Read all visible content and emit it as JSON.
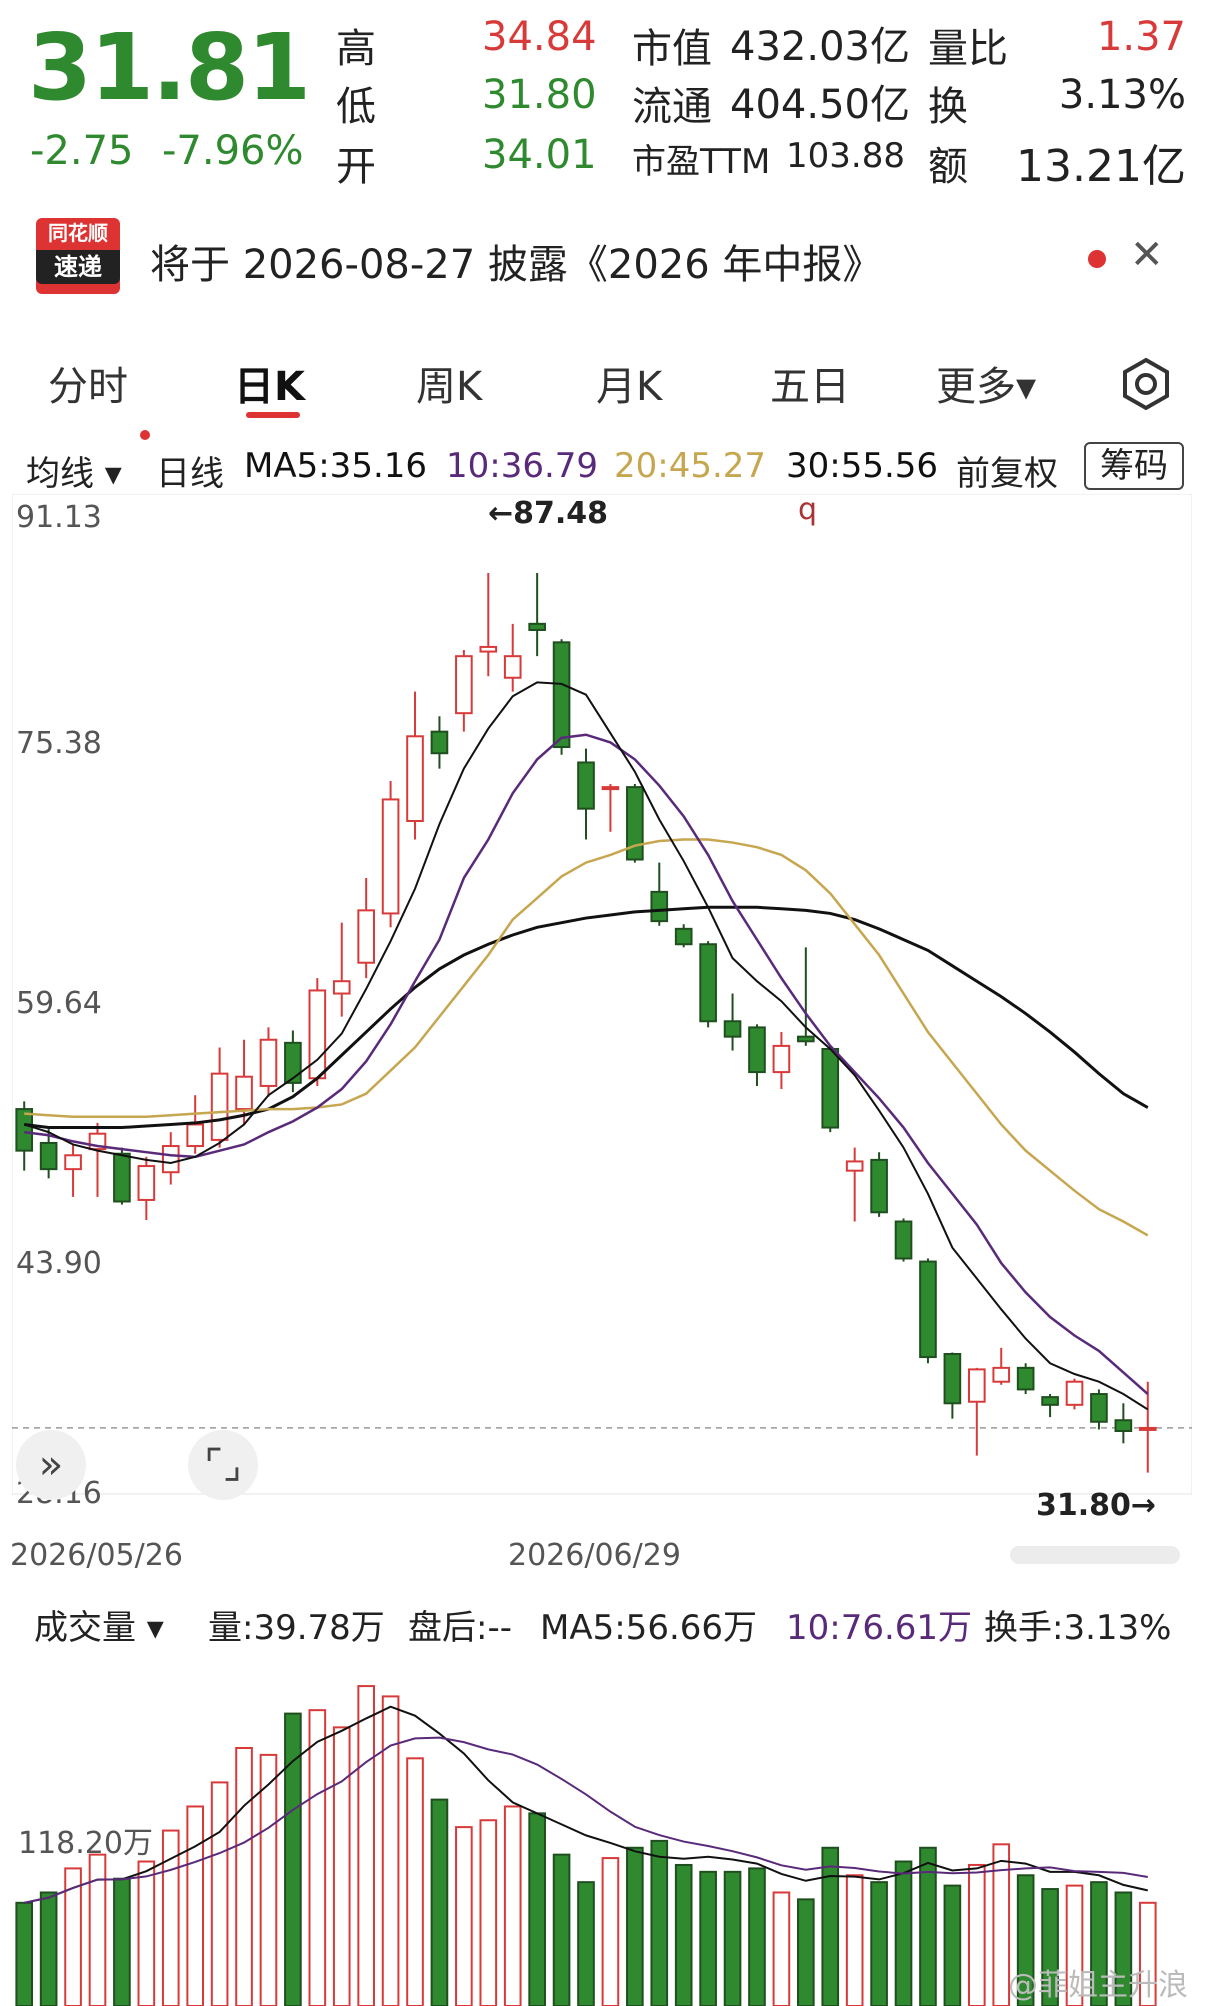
{
  "quote": {
    "price": "31.81",
    "change": "-2.75",
    "change_pct": "-7.96%",
    "high_label": "高",
    "high": "34.84",
    "low_label": "低",
    "low": "31.80",
    "open_label": "开",
    "open": "34.01",
    "mktcap_label": "市值",
    "mktcap": "432.03亿",
    "float_label": "流通",
    "float": "404.50亿",
    "pe_label": "市盈TTM",
    "pe": "103.88",
    "volratio_label": "量比",
    "volratio": "1.37",
    "turnover_label": "换",
    "turnover": "3.13%",
    "amount_label": "额",
    "amount": "13.21亿"
  },
  "banner": {
    "logo_top": "同花顺",
    "logo_bottom": "速递",
    "text": "将于 2026-08-27 披露《2026 年中报》",
    "close_icon": "close-icon"
  },
  "tabs": [
    "分时",
    "日K",
    "周K",
    "月K",
    "五日",
    "更多▾"
  ],
  "active_tab": 1,
  "ma_bar": {
    "selector": "均线 ▾",
    "period": "日线",
    "ma5": "MA5:35.16",
    "ma10": "10:36.79",
    "ma20": "20:45.27",
    "ma30": "30:55.56",
    "adjust": "前复权",
    "chip": "筹码"
  },
  "colors": {
    "up": "#d83a3a",
    "down": "#2f8a2f",
    "ma5": "#111111",
    "ma10": "#5a2a7a",
    "ma20": "#c7a650",
    "ma30": "#111111"
  },
  "price_axis": {
    "ticks": [
      "91.13",
      "75.38",
      "59.64",
      "43.90",
      "28.16"
    ]
  },
  "annotations": {
    "high_marker": "←87.48",
    "low_marker": "31.80→",
    "q_marker": "q"
  },
  "date_axis": {
    "start": "2026/05/26",
    "mid": "2026/06/29"
  },
  "volume_bar": {
    "selector": "成交量 ▾",
    "vol": "量:39.78万",
    "after": "盘后:--",
    "ma5": "MA5:56.66万",
    "ma10": "10:76.61万",
    "turnover": "换手:3.13%",
    "tick": "118.20万"
  },
  "watermark": "@菲姐主升浪",
  "chart_data": {
    "type": "candlestick",
    "ylim": [
      28.16,
      91.13
    ],
    "candles": [
      {
        "o": 52.5,
        "c": 49.8,
        "h": 53.0,
        "l": 48.5
      },
      {
        "o": 50.3,
        "c": 48.6,
        "h": 51.2,
        "l": 48.0
      },
      {
        "o": 48.6,
        "c": 49.5,
        "h": 50.2,
        "l": 46.8
      },
      {
        "o": 49.9,
        "c": 50.9,
        "h": 51.6,
        "l": 46.8
      },
      {
        "o": 49.6,
        "c": 46.5,
        "h": 50.0,
        "l": 46.3
      },
      {
        "o": 46.6,
        "c": 48.8,
        "h": 49.4,
        "l": 45.3
      },
      {
        "o": 48.4,
        "c": 50.1,
        "h": 51.0,
        "l": 47.6
      },
      {
        "o": 50.1,
        "c": 51.5,
        "h": 53.4,
        "l": 49.6
      },
      {
        "o": 50.5,
        "c": 54.8,
        "h": 56.5,
        "l": 50.0
      },
      {
        "o": 52.5,
        "c": 54.6,
        "h": 57.0,
        "l": 51.5
      },
      {
        "o": 54.0,
        "c": 57.0,
        "h": 57.8,
        "l": 53.3
      },
      {
        "o": 56.8,
        "c": 54.2,
        "h": 57.6,
        "l": 53.6
      },
      {
        "o": 54.5,
        "c": 60.2,
        "h": 61.0,
        "l": 54.0
      },
      {
        "o": 60.0,
        "c": 60.8,
        "h": 64.6,
        "l": 58.5
      },
      {
        "o": 62.0,
        "c": 65.4,
        "h": 67.5,
        "l": 61.0
      },
      {
        "o": 65.2,
        "c": 72.6,
        "h": 73.8,
        "l": 64.3
      },
      {
        "o": 71.2,
        "c": 76.7,
        "h": 79.6,
        "l": 70.0
      },
      {
        "o": 77.0,
        "c": 75.6,
        "h": 78.0,
        "l": 74.6
      },
      {
        "o": 78.2,
        "c": 81.9,
        "h": 82.3,
        "l": 77.0
      },
      {
        "o": 82.2,
        "c": 82.5,
        "h": 87.3,
        "l": 80.6
      },
      {
        "o": 80.5,
        "c": 81.9,
        "h": 84.0,
        "l": 79.6
      },
      {
        "o": 84.0,
        "c": 83.6,
        "h": 87.3,
        "l": 81.9
      },
      {
        "o": 82.8,
        "c": 76.0,
        "h": 83.0,
        "l": 75.5
      },
      {
        "o": 75.0,
        "c": 72.0,
        "h": 75.9,
        "l": 70.0
      },
      {
        "o": 73.4,
        "c": 73.4,
        "h": 73.6,
        "l": 70.5
      },
      {
        "o": 73.4,
        "c": 68.7,
        "h": 73.6,
        "l": 68.5
      },
      {
        "o": 66.6,
        "c": 64.7,
        "h": 68.5,
        "l": 64.4
      },
      {
        "o": 64.2,
        "c": 63.2,
        "h": 64.5,
        "l": 63.0
      },
      {
        "o": 63.2,
        "c": 58.2,
        "h": 63.4,
        "l": 57.8
      },
      {
        "o": 58.2,
        "c": 57.2,
        "h": 60.0,
        "l": 56.3
      },
      {
        "o": 57.8,
        "c": 54.9,
        "h": 58.0,
        "l": 54.0
      },
      {
        "o": 54.9,
        "c": 56.6,
        "h": 57.5,
        "l": 53.8
      },
      {
        "o": 57.2,
        "c": 56.9,
        "h": 63.0,
        "l": 56.6
      },
      {
        "o": 56.4,
        "c": 51.3,
        "h": 56.6,
        "l": 51.0
      },
      {
        "o": 48.5,
        "c": 49.1,
        "h": 50.0,
        "l": 45.2
      },
      {
        "o": 49.2,
        "c": 45.8,
        "h": 49.7,
        "l": 45.5
      },
      {
        "o": 45.2,
        "c": 42.8,
        "h": 45.4,
        "l": 42.6
      },
      {
        "o": 42.6,
        "c": 36.4,
        "h": 42.8,
        "l": 36.0
      },
      {
        "o": 36.6,
        "c": 33.4,
        "h": 36.7,
        "l": 32.4
      },
      {
        "o": 33.5,
        "c": 35.6,
        "h": 35.7,
        "l": 30.0
      },
      {
        "o": 34.8,
        "c": 35.7,
        "h": 37.0,
        "l": 34.6
      },
      {
        "o": 35.7,
        "c": 34.3,
        "h": 36.0,
        "l": 34.0
      },
      {
        "o": 33.8,
        "c": 33.3,
        "h": 34.0,
        "l": 32.5
      },
      {
        "o": 33.3,
        "c": 34.8,
        "h": 35.0,
        "l": 33.0
      },
      {
        "o": 34.0,
        "c": 32.2,
        "h": 34.3,
        "l": 31.7
      },
      {
        "o": 32.3,
        "c": 31.6,
        "h": 33.4,
        "l": 30.8
      },
      {
        "o": 31.8,
        "c": 31.8,
        "h": 34.8,
        "l": 28.9
      }
    ],
    "ma5": [
      51.5,
      51.0,
      50.2,
      49.8,
      49.5,
      49.2,
      49.0,
      49.4,
      50.3,
      51.5,
      53.4,
      54.5,
      55.7,
      57.4,
      60.3,
      63.4,
      66.8,
      71.0,
      74.6,
      77.2,
      79.3,
      80.2,
      80.1,
      79.4,
      76.9,
      74.4,
      71.3,
      68.6,
      65.6,
      62.3,
      60.8,
      59.5,
      57.8,
      56.4,
      54.7,
      52.4,
      50.0,
      47.0,
      43.5,
      41.5,
      39.5,
      37.6,
      36.0,
      35.3,
      34.8,
      34.0,
      33.0
    ],
    "ma10": [
      51.0,
      50.8,
      50.4,
      50.1,
      49.9,
      49.7,
      49.5,
      49.4,
      49.8,
      50.2,
      51.0,
      51.7,
      52.6,
      53.8,
      55.6,
      58.0,
      60.8,
      63.5,
      67.5,
      70.0,
      73.0,
      75.2,
      76.6,
      76.8,
      76.3,
      75.2,
      73.5,
      71.5,
      69.0,
      66.0,
      63.5,
      61.0,
      58.7,
      56.6,
      54.9,
      53.2,
      51.3,
      49.0,
      47.0,
      45.0,
      42.5,
      40.6,
      39.0,
      37.8,
      36.8,
      35.4,
      34.0
    ],
    "ma20": [
      52.2,
      52.1,
      52.0,
      52.0,
      52.0,
      52.0,
      52.1,
      52.2,
      52.3,
      52.4,
      52.5,
      52.5,
      52.6,
      52.8,
      53.5,
      55.0,
      56.5,
      58.5,
      60.5,
      62.5,
      64.8,
      66.2,
      67.6,
      68.5,
      69.0,
      69.6,
      69.9,
      70.0,
      70.0,
      69.8,
      69.5,
      69.0,
      68.0,
      66.5,
      64.5,
      62.5,
      60.0,
      57.5,
      55.5,
      53.5,
      51.5,
      49.8,
      48.5,
      47.2,
      46.0,
      45.2,
      44.3
    ],
    "ma30": [
      51.5,
      51.3,
      51.3,
      51.3,
      51.3,
      51.4,
      51.5,
      51.6,
      51.8,
      52.1,
      52.5,
      53.3,
      54.5,
      56.0,
      57.5,
      59.0,
      60.4,
      61.6,
      62.5,
      63.2,
      63.8,
      64.3,
      64.6,
      64.9,
      65.1,
      65.3,
      65.4,
      65.5,
      65.6,
      65.6,
      65.6,
      65.5,
      65.4,
      65.2,
      64.8,
      64.2,
      63.5,
      62.8,
      61.8,
      60.8,
      59.8,
      58.7,
      57.5,
      56.2,
      54.8,
      53.5,
      52.6
    ],
    "volume": [
      30,
      33,
      40,
      44,
      37,
      42,
      51,
      58,
      65,
      75,
      73,
      85,
      86,
      81,
      93,
      90,
      72,
      60,
      52,
      54,
      58,
      56,
      44,
      36,
      43,
      46,
      48,
      41,
      39,
      39,
      40,
      33,
      31,
      46,
      38,
      36,
      42,
      46,
      35,
      41,
      47,
      38,
      34,
      35,
      36,
      33,
      30
    ]
  }
}
